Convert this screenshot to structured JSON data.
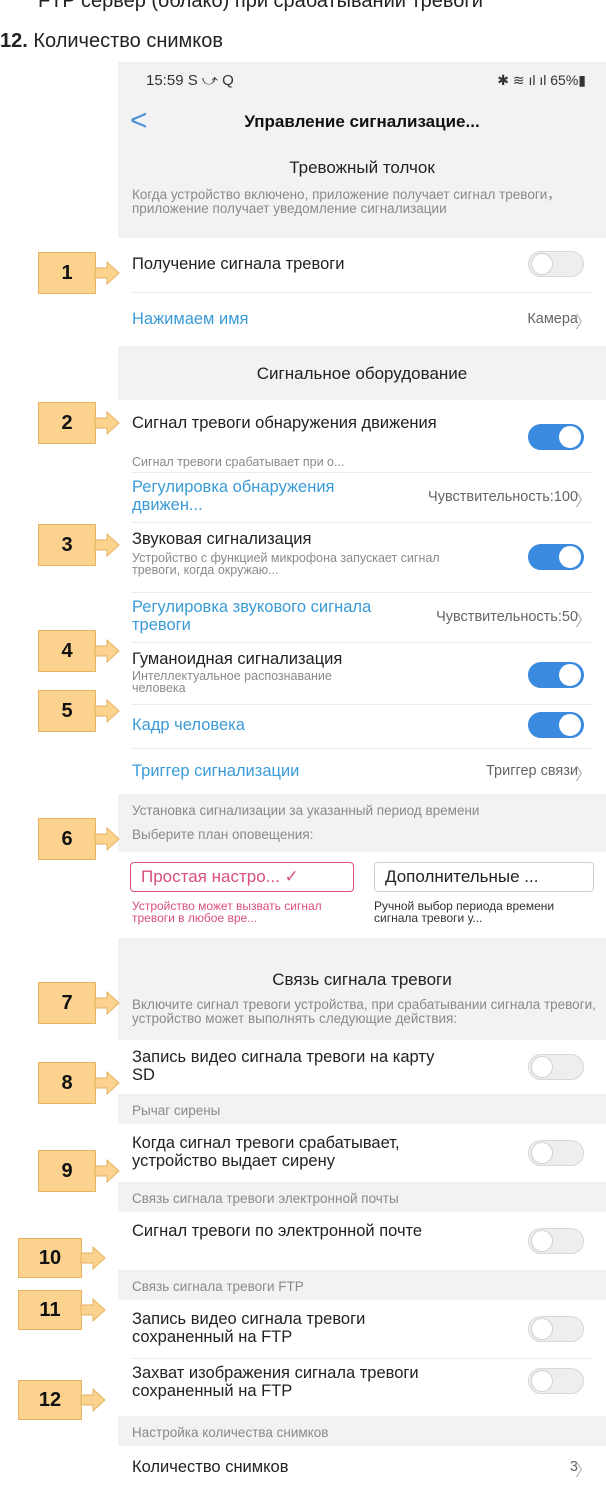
{
  "doc": {
    "line1": "FTP сервер (облако) при срабатывании тревоги",
    "line2_num": "12.",
    "line2_text": "Количество снимков"
  },
  "status_bar": {
    "time": "15:59 S ⤻ Q",
    "right": "✱ ≋ ıl ıl 65%▮"
  },
  "nav": {
    "back": "<",
    "title": "Управление сигнализацие..."
  },
  "push": {
    "header": "Тревожный толчок",
    "hint": "Когда устройство включено, приложение получает сигнал тревоги，приложение получает уведомление сигнализации",
    "receive_label": "Получение сигнала тревоги",
    "receive_on": false,
    "name_label": "Нажимаем имя",
    "name_value": "Камера"
  },
  "equipment": {
    "header": "Сигнальное оборудование",
    "motion_label": "Сигнал тревоги обнаружения движения",
    "motion_sub": "Сигнал тревоги срабатывает при о...",
    "motion_on": true,
    "motion_adjust_label": "Регулировка обнаружения движен...",
    "motion_adjust_value": "Чувствительность:100",
    "sound_label": "Звуковая сигнализация",
    "sound_sub": "Устройство с функцией микрофона запускает сигнал тревоги, когда окружаю...",
    "sound_on": true,
    "sound_adjust_label": "Регулировка звукового сигнала тревоги",
    "sound_adjust_value": "Чувствительность:50",
    "humanoid_label": "Гуманоидная сигнализация",
    "humanoid_sub": "Интеллектуальное распознавание человека",
    "humanoid_on": true,
    "frame_label": "Кадр человека",
    "frame_on": true,
    "trigger_label": "Триггер сигнализации",
    "trigger_value": "Триггер связи"
  },
  "plan": {
    "hint1": "Установка сигнализации за указанный период времени",
    "hint2": "Выберите план оповещения:",
    "simple_label": "Простая настро... ✓",
    "simple_note": "Устройство может вызвать сигнал тревоги в любое вре...",
    "advanced_label": "Дополнительные ...",
    "advanced_note": "Ручной выбор периода времени сигнала тревоги у..."
  },
  "link": {
    "header": "Связь сигнала тревоги",
    "hint": "Включите сигнал тревоги устройства, при срабатывании сигнала тревоги, устройство может выполнять следующие действия:",
    "sd_label": "Запись видео сигнала тревоги на карту SD",
    "sd_on": false,
    "siren_section": "Рычаг сирены",
    "siren_label": "Когда сигнал тревоги срабатывает, устройство выдает сирену",
    "siren_on": false,
    "email_section": "Связь сигнала тревоги электронной почты",
    "email_label": "Сигнал тревоги по электронной почте",
    "email_on": false,
    "ftp_section": "Связь сигнала тревоги FTP",
    "ftp_video_label": "Запись видео сигнала тревоги сохраненный на FTP",
    "ftp_video_on": false,
    "ftp_image_label": "Захват изображения сигнала тревоги сохраненный на FTP",
    "ftp_image_on": false,
    "snap_section": "Настройка количества снимков",
    "snap_label": "Количество снимков",
    "snap_value": "3"
  },
  "markers": [
    "1",
    "2",
    "3",
    "4",
    "5",
    "6",
    "7",
    "8",
    "9",
    "10",
    "11",
    "12"
  ],
  "colors": {
    "accent": "#3a8be0",
    "link_text": "#3a9bd8",
    "marker_fill": "#fbd28e",
    "selected_plan": "#d94f7a"
  }
}
